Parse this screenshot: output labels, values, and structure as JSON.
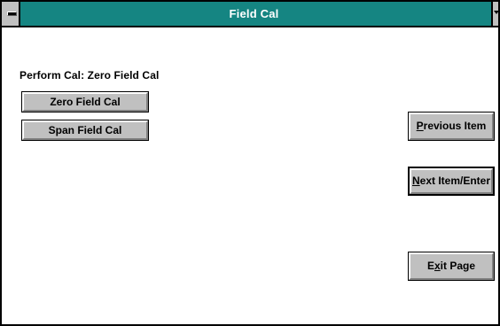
{
  "window": {
    "title": "Field Cal"
  },
  "status": {
    "perform_cal_label": "Perform Cal: Zero Field Cal"
  },
  "buttons": {
    "zero_field_cal": "Zero Field Cal",
    "span_field_cal": "Span Field Cal",
    "previous_item": {
      "mnemonic": "P",
      "rest": "revious Item"
    },
    "next_item": {
      "mnemonic": "N",
      "rest": "ext Item/Enter"
    },
    "exit_page": {
      "pre": "E",
      "mnemonic": "x",
      "rest": "it Page"
    }
  },
  "colors": {
    "titlebar": "#158582",
    "button_face": "#c0c0c0",
    "background": "#ffffff"
  },
  "icons": [
    "system-menu-icon",
    "scroll-arrow-icon"
  ]
}
